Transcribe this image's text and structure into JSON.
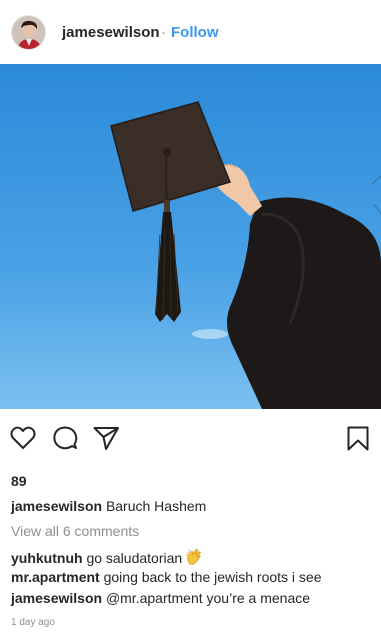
{
  "post": {
    "author": "jamesewilson",
    "separator": "·",
    "follow_label": "Follow",
    "likes": "89",
    "caption_user": "jamesewilson",
    "caption_text": "Baruch Hashem",
    "view_comments": "View all 6 comments",
    "timestamp": "1 day ago"
  },
  "comments": [
    {
      "user": "yuhkutnuh",
      "text": "go saludatorian",
      "emoji": "clapping-hands"
    },
    {
      "user": "mr.apartment",
      "text": "going back to the jewish roots i see"
    },
    {
      "user": "jamesewilson",
      "text": "@mr.apartment you’re a menace"
    }
  ],
  "icons": {
    "like": "heart-icon",
    "comment": "comment-bubble-icon",
    "share": "paper-plane-icon",
    "save": "bookmark-icon"
  },
  "colors": {
    "link_blue": "#3897f0",
    "text": "#262626",
    "muted": "#8e8e8e",
    "sky": "#3f9ae3"
  }
}
